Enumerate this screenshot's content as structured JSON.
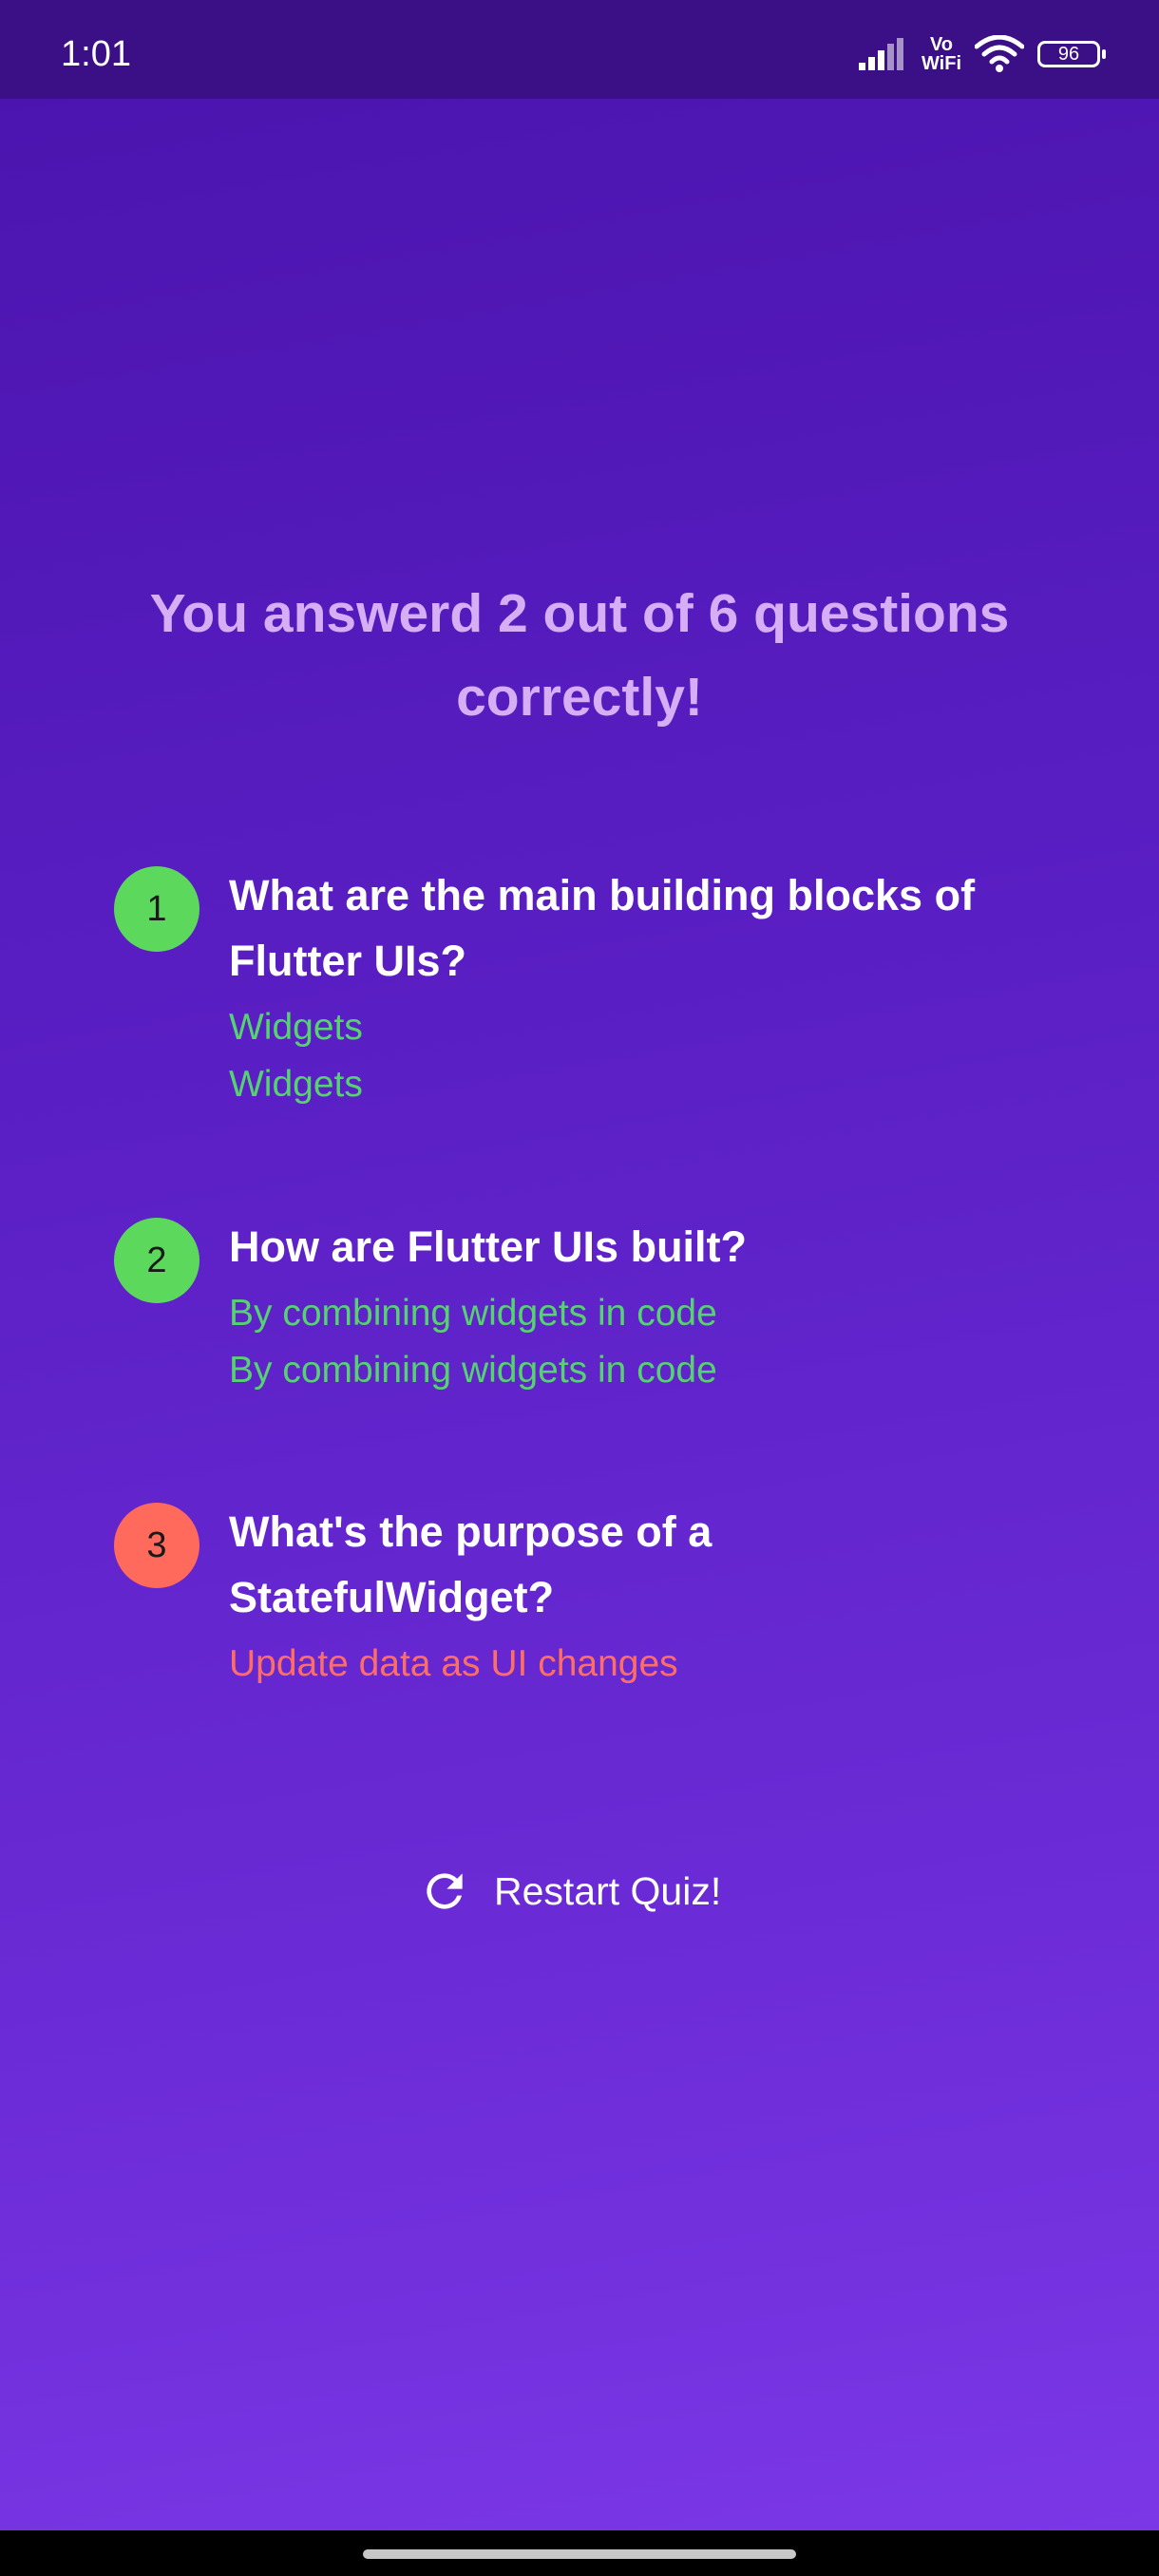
{
  "status_bar": {
    "time": "1:01",
    "vowifi_top": "Vo",
    "vowifi_bottom": "WiFi",
    "battery": "96"
  },
  "summary": {
    "text": "You answerd 2 out of 6 questions correctly!"
  },
  "results": [
    {
      "number": "1",
      "question": "What are the main building blocks of Flutter UIs?",
      "user_answer": "Widgets",
      "correct_answer": "Widgets",
      "status": "correct"
    },
    {
      "number": "2",
      "question": "How are Flutter UIs built?",
      "user_answer": "By combining widgets in code",
      "correct_answer": "By combining widgets in code",
      "status": "correct"
    },
    {
      "number": "3",
      "question": "What's the purpose of a StatefulWidget?",
      "user_answer": "Update data as UI changes",
      "status": "wrong"
    }
  ],
  "restart": {
    "label": "Restart Quiz!",
    "icon": "refresh-icon"
  },
  "colors": {
    "correct": "#5cd95c",
    "wrong": "#ff6a5c",
    "background_top": "#4a13ad",
    "background_bottom": "#7b37e6",
    "summary_text": "#d6aef5"
  }
}
